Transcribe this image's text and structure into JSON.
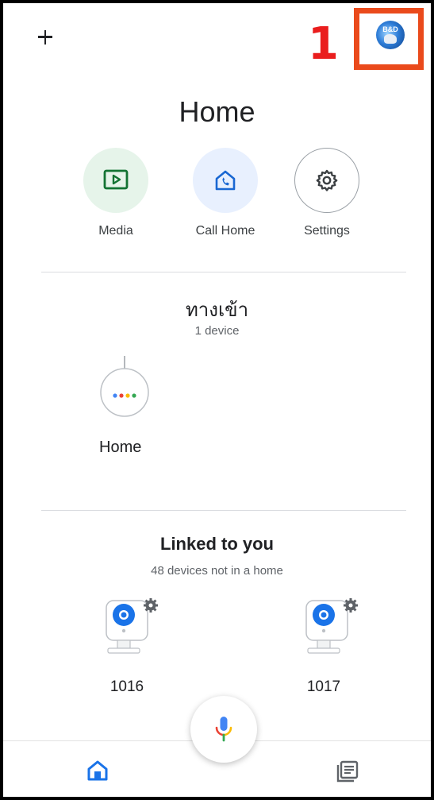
{
  "header": {
    "add_icon": "plus-icon",
    "annotation_number": "1",
    "annotation_color": "#ea1d1d",
    "highlight_color": "#ea4a1c",
    "avatar_text": "B&D"
  },
  "home": {
    "title": "Home",
    "actions": [
      {
        "label": "Media",
        "icon": "play-icon",
        "color": "#e6f4ea"
      },
      {
        "label": "Call Home",
        "icon": "call-home-icon",
        "color": "#e8f0fe"
      },
      {
        "label": "Settings",
        "icon": "gear-icon",
        "color": "#ffffff"
      }
    ]
  },
  "room": {
    "name": "ทางเข้า",
    "device_count": "1 device",
    "devices": [
      {
        "name": "Home",
        "icon": "smart-speaker-icon"
      }
    ]
  },
  "linked": {
    "title": "Linked to you",
    "subtitle": "48 devices not in a home",
    "devices": [
      {
        "name": "1016",
        "icon": "camera-icon"
      },
      {
        "name": "1017",
        "icon": "camera-icon"
      }
    ]
  },
  "assistant": {
    "icon": "microphone-icon"
  },
  "bottom_nav": {
    "items": [
      {
        "icon": "home-icon",
        "active": true,
        "color": "#1a73e8"
      },
      {
        "icon": "feed-icon",
        "active": false,
        "color": "#5f6368"
      }
    ]
  }
}
